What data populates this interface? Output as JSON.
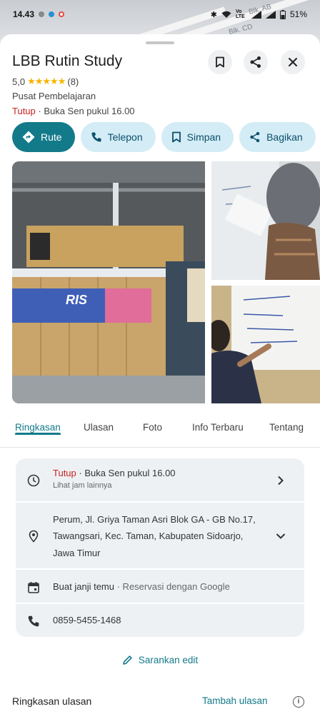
{
  "status_bar": {
    "time": "14.43",
    "network": "Vo LTE",
    "battery": "51%"
  },
  "map": {
    "labels": [
      "Blk. AB",
      "Blk. CD"
    ]
  },
  "place": {
    "name": "LBB Rutin Study",
    "rating": "5,0",
    "stars": "★★★★★",
    "review_count": "(8)",
    "category": "Pusat Pembelajaran",
    "status": "Tutup",
    "open_info": " · Buka Sen pukul 16.00"
  },
  "header_buttons": {
    "save_icon": "bookmark-icon",
    "share_icon": "share-icon",
    "close_icon": "close-icon"
  },
  "chips": [
    {
      "label": "Rute",
      "icon": "directions-icon"
    },
    {
      "label": "Telepon",
      "icon": "phone-icon"
    },
    {
      "label": "Simpan",
      "icon": "bookmark-icon"
    },
    {
      "label": "Bagikan",
      "icon": "share-icon"
    }
  ],
  "photos": {
    "banner_text": "RIS"
  },
  "tabs": [
    {
      "label": "Ringkasan",
      "active": true
    },
    {
      "label": "Ulasan",
      "active": false
    },
    {
      "label": "Foto",
      "active": false
    },
    {
      "label": "Info Terbaru",
      "active": false
    },
    {
      "label": "Tentang",
      "active": false
    }
  ],
  "info": {
    "hours_status": "Tutup",
    "hours_text": " · Buka Sen pukul 16.00",
    "hours_sub": "Lihat jam lainnya",
    "address_line1": "Perum, Jl. Griya Taman Asri Blok GA - GB No.17,",
    "address_line2": "Tawangsari, Kec. Taman, Kabupaten Sidoarjo,",
    "address_line3": "Jawa Timur",
    "booking_label": "Buat janji temu",
    "booking_provider": " · Reservasi dengan Google",
    "phone": "0859-5455-1468"
  },
  "suggest_edit": "Sarankan edit",
  "reviews": {
    "title": "Ringkasan ulasan",
    "add_label": "Tambah ulasan",
    "info_glyph": "i"
  },
  "colors": {
    "accent": "#137a8a",
    "chip_bg": "#d3ecf5",
    "closed": "#c5221f",
    "stars": "#f5b400"
  }
}
